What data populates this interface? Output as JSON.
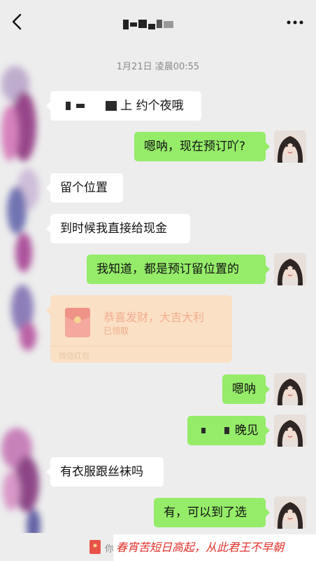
{
  "header": {
    "back_icon": "chevron-left-icon",
    "more_icon": "more-horizontal-icon"
  },
  "timestamp": "1月21日 凌晨00:55",
  "messages": [
    {
      "side": "in",
      "text": "上 约个夜哦"
    },
    {
      "side": "out",
      "text": "嗯呐，现在预订吖?"
    },
    {
      "side": "in",
      "text": "留个位置"
    },
    {
      "side": "in",
      "text": "到时候我直接给现金"
    },
    {
      "side": "out",
      "text": "我知道，都是预订留位置的"
    },
    {
      "side": "out",
      "text": "嗯呐"
    },
    {
      "side": "out",
      "text": "晚见"
    },
    {
      "side": "in",
      "text": "有衣服跟丝袜吗"
    },
    {
      "side": "out",
      "text": "有，可以到了选"
    }
  ],
  "red_packet": {
    "title": "恭喜发财，大吉大利",
    "status": "已领取",
    "footer": "微信红包",
    "icon": "red-envelope-icon"
  },
  "footer": {
    "partial_text": "你",
    "icon": "red-envelope-icon"
  },
  "watermark": "春宵苦短日高起，从此君王不早朝",
  "colors": {
    "background": "#ededed",
    "incoming_bubble": "#ffffff",
    "outgoing_bubble": "#95ec69",
    "red_packet": "#fbe0c2",
    "watermark_text": "#e0302a"
  }
}
